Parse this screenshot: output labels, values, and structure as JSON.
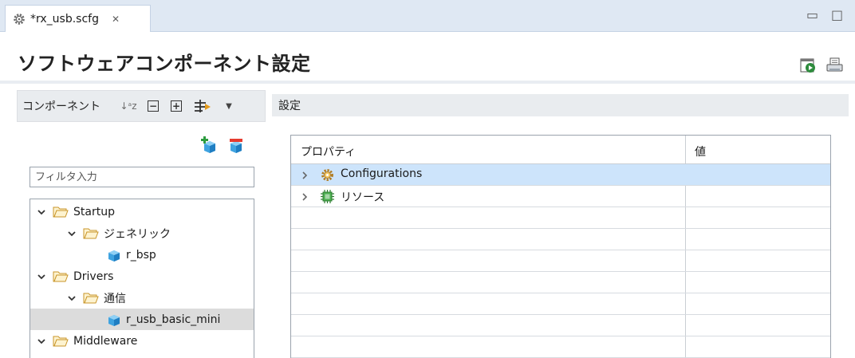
{
  "editor_tab": {
    "title": "*rx_usb.scfg",
    "close_glyph": "✕"
  },
  "window_controls": {
    "minimize_glyph": "▭",
    "maximize_glyph": "□"
  },
  "header": {
    "title": "ソフトウェアコンポーネント設定",
    "icons": [
      "run-config-icon",
      "print-icon"
    ]
  },
  "left_panel": {
    "title": "コンポーネント",
    "toolbar_icons": [
      "sort-az-icon",
      "collapse-all-icon",
      "expand-all-icon",
      "filter-icon",
      "view-menu-icon"
    ],
    "sort_glyph": "↓ᵃz",
    "collapse_glyph": "−",
    "expand_glyph": "+",
    "menu_glyph": "▼",
    "filter_placeholder": "フィルタ入力",
    "tree": [
      {
        "label": "Startup",
        "level": 0,
        "type": "folder",
        "expanded": true
      },
      {
        "label": "ジェネリック",
        "level": 1,
        "type": "folder",
        "expanded": true
      },
      {
        "label": "r_bsp",
        "level": 2,
        "type": "component"
      },
      {
        "label": "Drivers",
        "level": 0,
        "type": "folder",
        "expanded": true
      },
      {
        "label": "通信",
        "level": 1,
        "type": "folder",
        "expanded": true
      },
      {
        "label": "r_usb_basic_mini",
        "level": 2,
        "type": "component",
        "selected": true
      },
      {
        "label": "Middleware",
        "level": 0,
        "type": "folder",
        "expanded": true
      }
    ]
  },
  "right_panel": {
    "title": "設定",
    "columns": [
      "プロパティ",
      "値"
    ],
    "rows": [
      {
        "label": "Configurations",
        "icon": "gear-icon",
        "value": "",
        "selected": true
      },
      {
        "label": "リソース",
        "icon": "chip-icon",
        "value": "",
        "selected": false
      }
    ]
  },
  "colors": {
    "tab_strip": "#dfe8f3",
    "panel_header": "#e9ecef",
    "row_selected": "#cde4fb",
    "tree_selected": "#dcdcdc",
    "folder_outline": "#c9962a"
  }
}
